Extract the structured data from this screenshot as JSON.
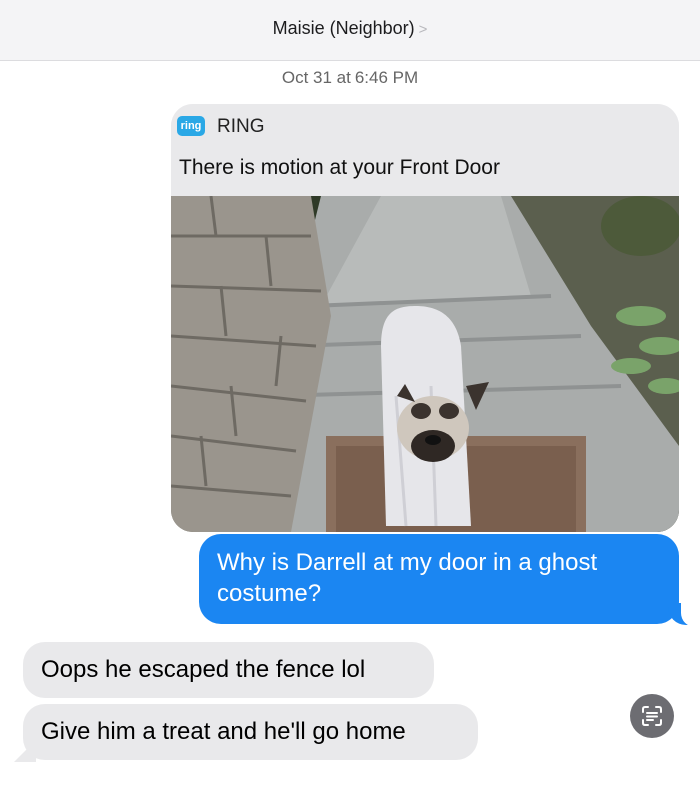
{
  "header": {
    "contact_name": "Maisie (Neighbor)",
    "chevron_glyph": ">"
  },
  "timestamp": {
    "date": "Oct 31 at",
    "time": "6:46 PM"
  },
  "ring_card": {
    "logo_text": "ring",
    "app_name": "RING",
    "message": "There is motion at your Front Door",
    "brand_color": "#2aa8e6"
  },
  "messages": {
    "outgoing_1": "Why is Darrell at my door in a ghost costume?",
    "incoming_1": "Oops he escaped the fence lol",
    "incoming_2": "Give him a treat and he'll go home"
  },
  "colors": {
    "outgoing_bubble": "#1b86f2",
    "incoming_bubble": "#e9e9eb"
  },
  "icons": {
    "live_text": "live-text-icon"
  }
}
